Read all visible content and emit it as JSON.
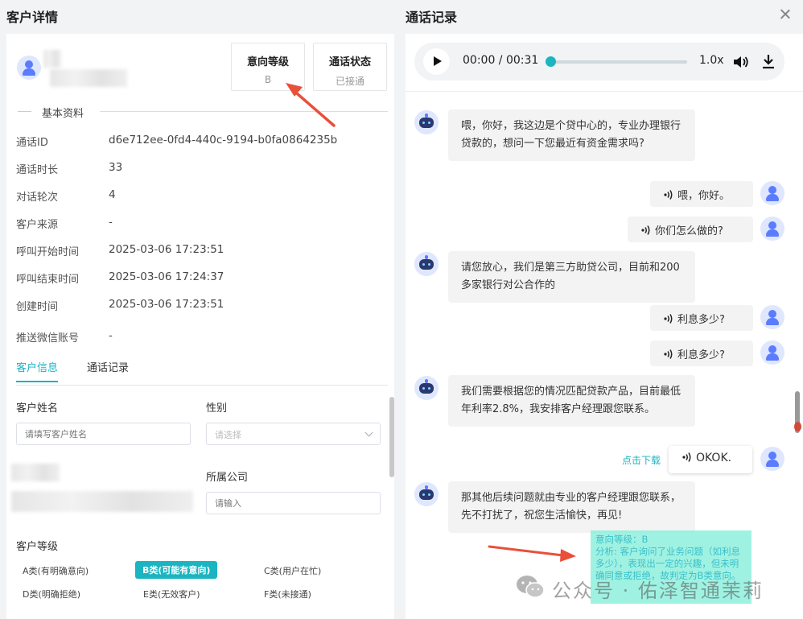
{
  "left_panel": {
    "title": "客户详情",
    "stats": [
      {
        "label": "意向等级",
        "value": "B"
      },
      {
        "label": "通话状态",
        "value": "已接通"
      }
    ],
    "section_title": "基本资料",
    "info": [
      {
        "key": "通话ID",
        "value": "d6e712ee-0fd4-440c-9194-b0fa0864235b"
      },
      {
        "key": "通话时长",
        "value": "33"
      },
      {
        "key": "对话轮次",
        "value": "4"
      },
      {
        "key": "客户来源",
        "value": "-"
      },
      {
        "key": "呼叫开始时间",
        "value": "2025-03-06 17:23:51"
      },
      {
        "key": "呼叫结束时间",
        "value": "2025-03-06 17:24:37"
      },
      {
        "key": "创建时间",
        "value": "2025-03-06 17:23:51"
      },
      {
        "key": "推送微信账号",
        "value": "-"
      }
    ],
    "tabs": [
      "客户信息",
      "通话记录"
    ],
    "form": {
      "name_label": "客户姓名",
      "name_placeholder": "请填写客户姓名",
      "gender_label": "性别",
      "gender_placeholder": "请选择",
      "company_label": "所属公司",
      "company_placeholder": "请输入",
      "grade_label": "客户等级",
      "grades": [
        "A类(有明确意向)",
        "B类(可能有意向)",
        "C类(用户在忙)",
        "D类(明确拒绝)",
        "E类(无效客户)",
        "F类(未接通)"
      ]
    }
  },
  "right_panel": {
    "title": "通话记录",
    "player": {
      "time": "00:00 / 00:31",
      "speed": "1.0x",
      "progress": 0.0
    },
    "messages": [
      {
        "role": "bot",
        "text": "喂，你好，我这边是个贷中心的，专业办理银行贷款的，想问一下您最近有资金需求吗?"
      },
      {
        "role": "user",
        "text": "喂，你好。"
      },
      {
        "role": "user",
        "text": "你们怎么做的?"
      },
      {
        "role": "bot",
        "text": "请您放心，我们是第三方助贷公司，目前和200多家银行对公合作的"
      },
      {
        "role": "user",
        "text": "利息多少?"
      },
      {
        "role": "user",
        "text": "利息多少?"
      },
      {
        "role": "bot",
        "text": "我们需要根据您的情况匹配贷款产品，目前最低年利率2.8%，我安排客户经理跟您联系。"
      },
      {
        "role": "user",
        "text": "OKOK."
      },
      {
        "role": "bot",
        "text": "那其他后续问题就由专业的客户经理跟您联系，先不打扰了，祝您生活愉快，再见!"
      }
    ],
    "download_link": "点击下载",
    "analysis": "意向等级：B\n分析: 客户询问了业务问题（如利息多少），表现出一定的兴趣，但未明确同意或拒绝，故判定为B类意向。"
  },
  "watermark": "公众号 · 佑泽智通茉莉",
  "colors": {
    "accent": "#1ab5c1",
    "arrow": "#e8503a",
    "bubble": "#f3f3f3",
    "avatar": "#5b7cff"
  }
}
